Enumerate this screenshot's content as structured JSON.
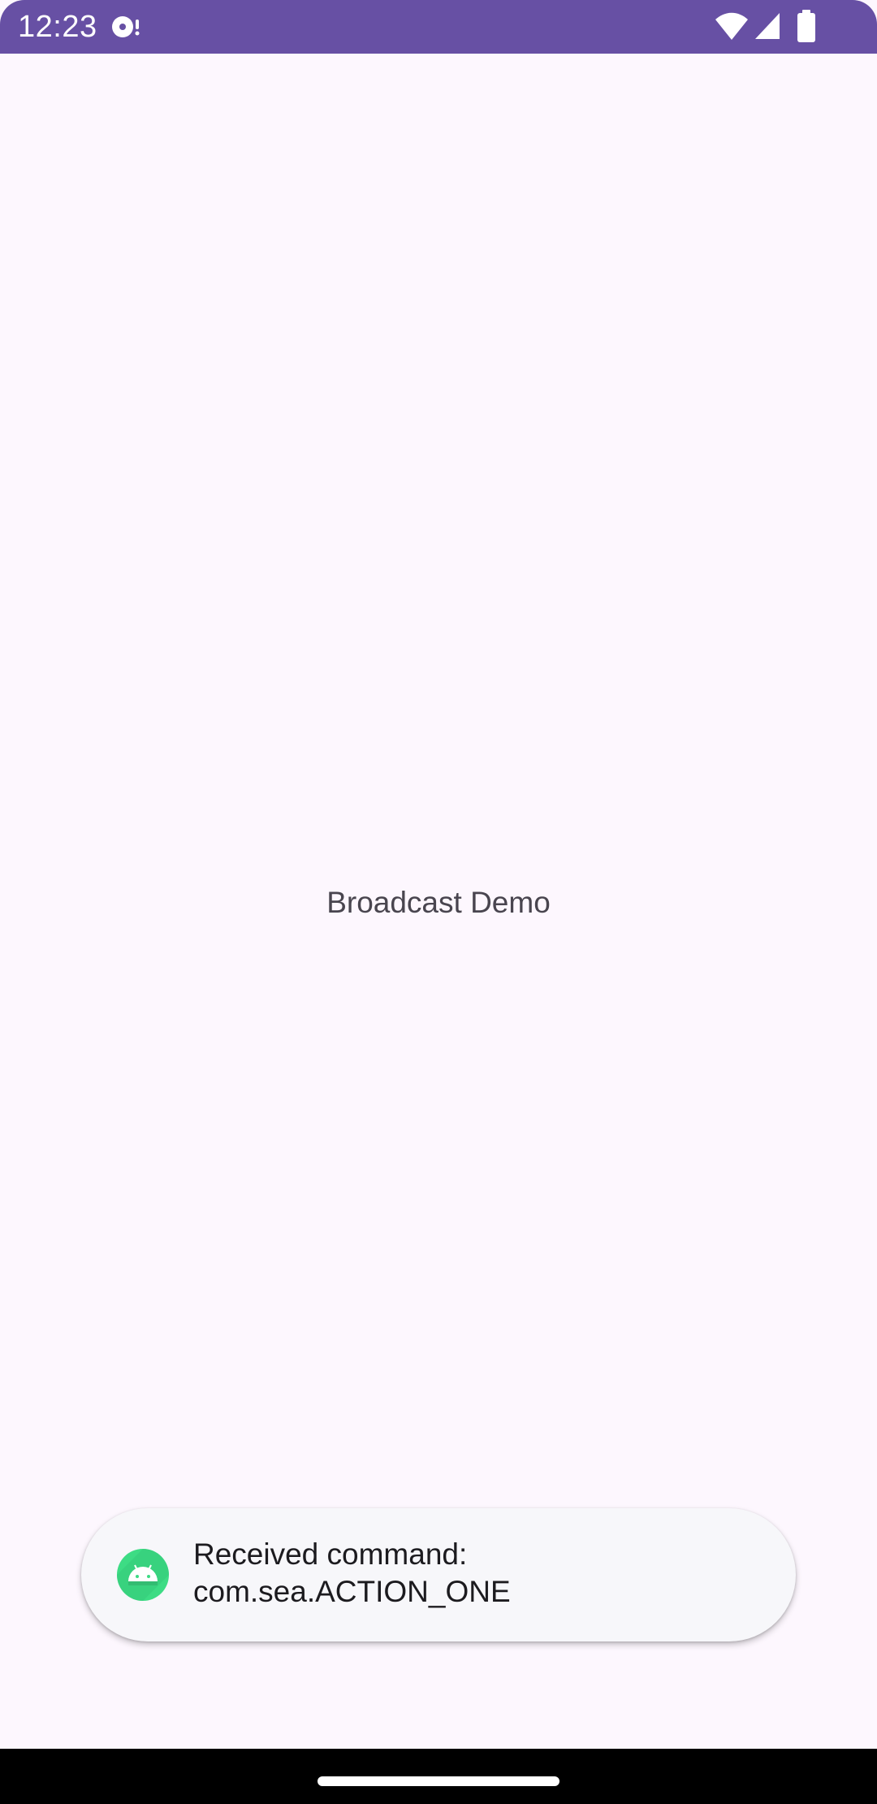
{
  "status_bar": {
    "time": "12:23",
    "background": "#6750A4",
    "icons": [
      "media-icon",
      "wifi-icon",
      "signal-icon",
      "battery-icon"
    ]
  },
  "main": {
    "center_text": "Broadcast Demo",
    "background": "#FDF7FE"
  },
  "toast": {
    "icon": "android-icon",
    "line1": "Received command:",
    "line2": "com.sea.ACTION_ONE"
  },
  "nav_bar": {
    "handle": "home-handle"
  }
}
